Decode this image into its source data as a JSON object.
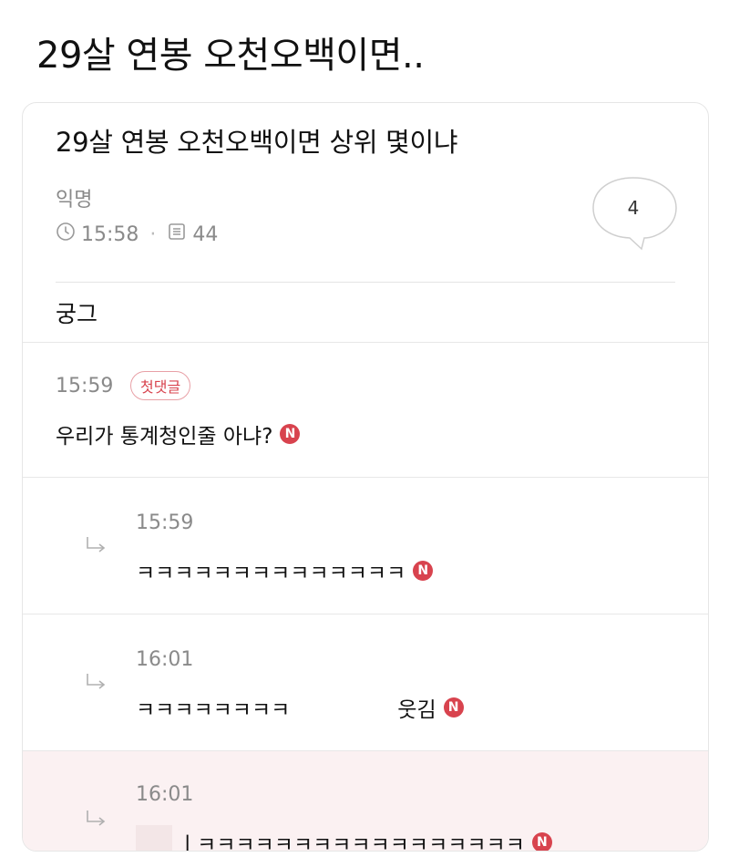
{
  "page": {
    "title": "29살 연봉 오천오백이면.."
  },
  "post": {
    "title": "29살 연봉 오천오백이면 상위 몇이냐",
    "author": "익명",
    "time": "15:58",
    "views": "44",
    "comment_count": "4",
    "body": "궁그"
  },
  "comments": [
    {
      "time": "15:59",
      "badge": "첫댓글",
      "text": "우리가 통계청인줄 아냐?",
      "new_label": "N"
    }
  ],
  "replies": [
    {
      "time": "15:59",
      "text": "ㅋㅋㅋㅋㅋㅋㅋㅋㅋㅋㅋㅋㅋㅋ",
      "new_label": "N"
    },
    {
      "time": "16:01",
      "text": "ㅋㅋㅋㅋㅋㅋㅋㅋ",
      "text_tail": "웃김",
      "new_label": "N"
    },
    {
      "time": "16:01",
      "text": "ㅣㅋㅋㅋㅋㅋㅋㅋㅋㅋㅋㅋㅋㅋㅋㅋㅋㅋ",
      "new_label": "N"
    }
  ],
  "colors": {
    "accent": "#d8434e",
    "muted": "#8a8a8a",
    "highlight": "#fbf1f2"
  },
  "icons": [
    "clock-icon",
    "views-icon",
    "comment-bubble-icon",
    "reply-arrow-icon",
    "new-badge-icon"
  ]
}
